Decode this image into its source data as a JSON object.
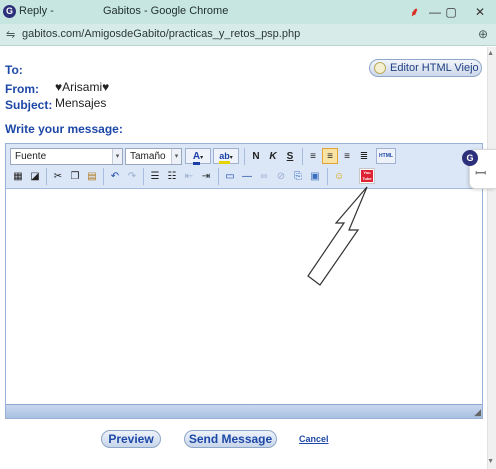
{
  "window": {
    "tab_label": "Reply -",
    "title": "Gabitos - Google Chrome",
    "logo_letter": "G",
    "pin_glyph": "⸙",
    "minimize_glyph": "—",
    "maximize_glyph": "▢",
    "close_glyph": "✕"
  },
  "address": {
    "url": "gabitos.com/AmigosdeGabito/practicas_y_retos_psp.php",
    "site_icon": "⇋",
    "zoom_glyph": "⊕"
  },
  "header": {
    "to_label": "To:",
    "from_label": "From:",
    "from_value": "♥Arisami♥",
    "subject_label": "Subject:",
    "subject_value": "Mensajes",
    "editor_toggle_label": "Editor HTML Viejo"
  },
  "compose": {
    "prompt": "Write your message:"
  },
  "toolbar": {
    "font_select": "Fuente",
    "size_select": "Tamaño",
    "dropdown_arrow": "▾",
    "text_color_glyph": "A",
    "highlight_glyph": "ab",
    "bold_glyph": "N",
    "italic_glyph": "K",
    "underline_glyph": "S",
    "html_label": "HTML",
    "youtube_label": "You Tube"
  },
  "actions": {
    "preview_label": "Preview",
    "send_label": "Send Message",
    "cancel_label": "Cancel"
  }
}
